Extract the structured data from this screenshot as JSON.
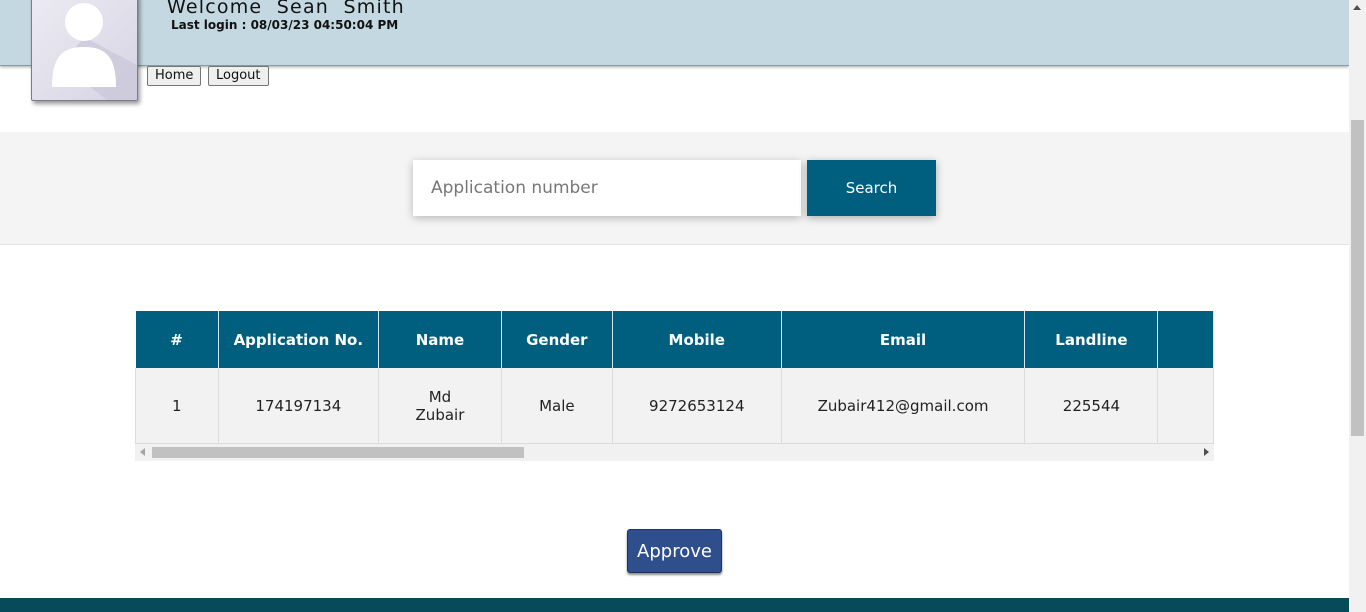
{
  "user": {
    "welcome_text": "Welcome  Sean  Smith",
    "last_login_label": "Last login : ",
    "last_login_value": "08/03/23 04:50:04 PM"
  },
  "nav": {
    "home_label": "Home",
    "logout_label": "Logout"
  },
  "search": {
    "placeholder": "Application number",
    "value": "",
    "button_label": "Search"
  },
  "table": {
    "headers": [
      "#",
      "Application No.",
      "Name",
      "Gender",
      "Mobile",
      "Email",
      "Landline"
    ],
    "rows": [
      {
        "index": "1",
        "application_no": "174197134",
        "name_line1": "Md",
        "name_line2": "Zubair",
        "gender": "Male",
        "mobile": "9272653124",
        "email": "Zubair412@gmail.com",
        "landline": "225544"
      }
    ]
  },
  "actions": {
    "approve_label": "Approve"
  },
  "colors": {
    "header_bg": "#c4d8e1",
    "accent": "#005f7f",
    "approve": "#2e4e8c",
    "footer": "#074a5a"
  },
  "icons": {
    "avatar": "user-silhouette-icon"
  }
}
